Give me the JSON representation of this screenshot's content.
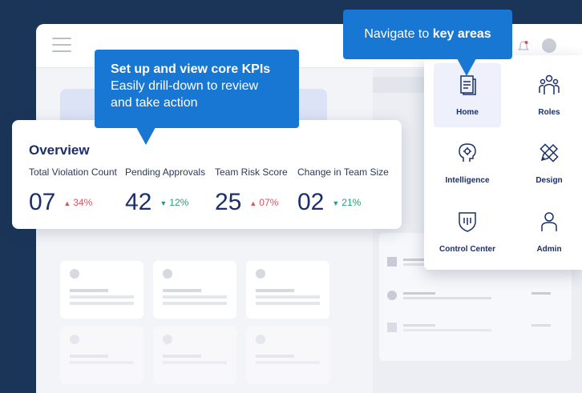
{
  "overview": {
    "title": "Overview",
    "metrics": [
      {
        "label": "Total Violation Count",
        "value": "07",
        "change": "34%",
        "direction": "up"
      },
      {
        "label": "Pending Approvals",
        "value": "42",
        "change": "12%",
        "direction": "down"
      },
      {
        "label": "Team Risk Score",
        "value": "25",
        "change": "07%",
        "direction": "up"
      },
      {
        "label": "Change in Team Size",
        "value": "02",
        "change": "21%",
        "direction": "down"
      }
    ]
  },
  "callouts": {
    "kpi_heading": "Set up and view core KPIs",
    "kpi_line1": "Easily drill-down to review",
    "kpi_line2": "and take action",
    "nav_prefix": "Navigate to",
    "nav_bold": "key areas"
  },
  "nav": {
    "items": [
      {
        "label": "Home",
        "icon": "document-icon",
        "active": true
      },
      {
        "label": "Roles",
        "icon": "roles-icon",
        "active": false
      },
      {
        "label": "Intelligence",
        "icon": "brain-icon",
        "active": false
      },
      {
        "label": "Design",
        "icon": "design-icon",
        "active": false
      },
      {
        "label": "Control Center",
        "icon": "shield-icon",
        "active": false
      },
      {
        "label": "Admin",
        "icon": "user-icon",
        "active": false
      }
    ]
  },
  "colors": {
    "accent": "#1877d2",
    "navy": "#1b2f6b",
    "up": "#d8525a",
    "down": "#2a9d6f",
    "background": "#1b3558"
  }
}
